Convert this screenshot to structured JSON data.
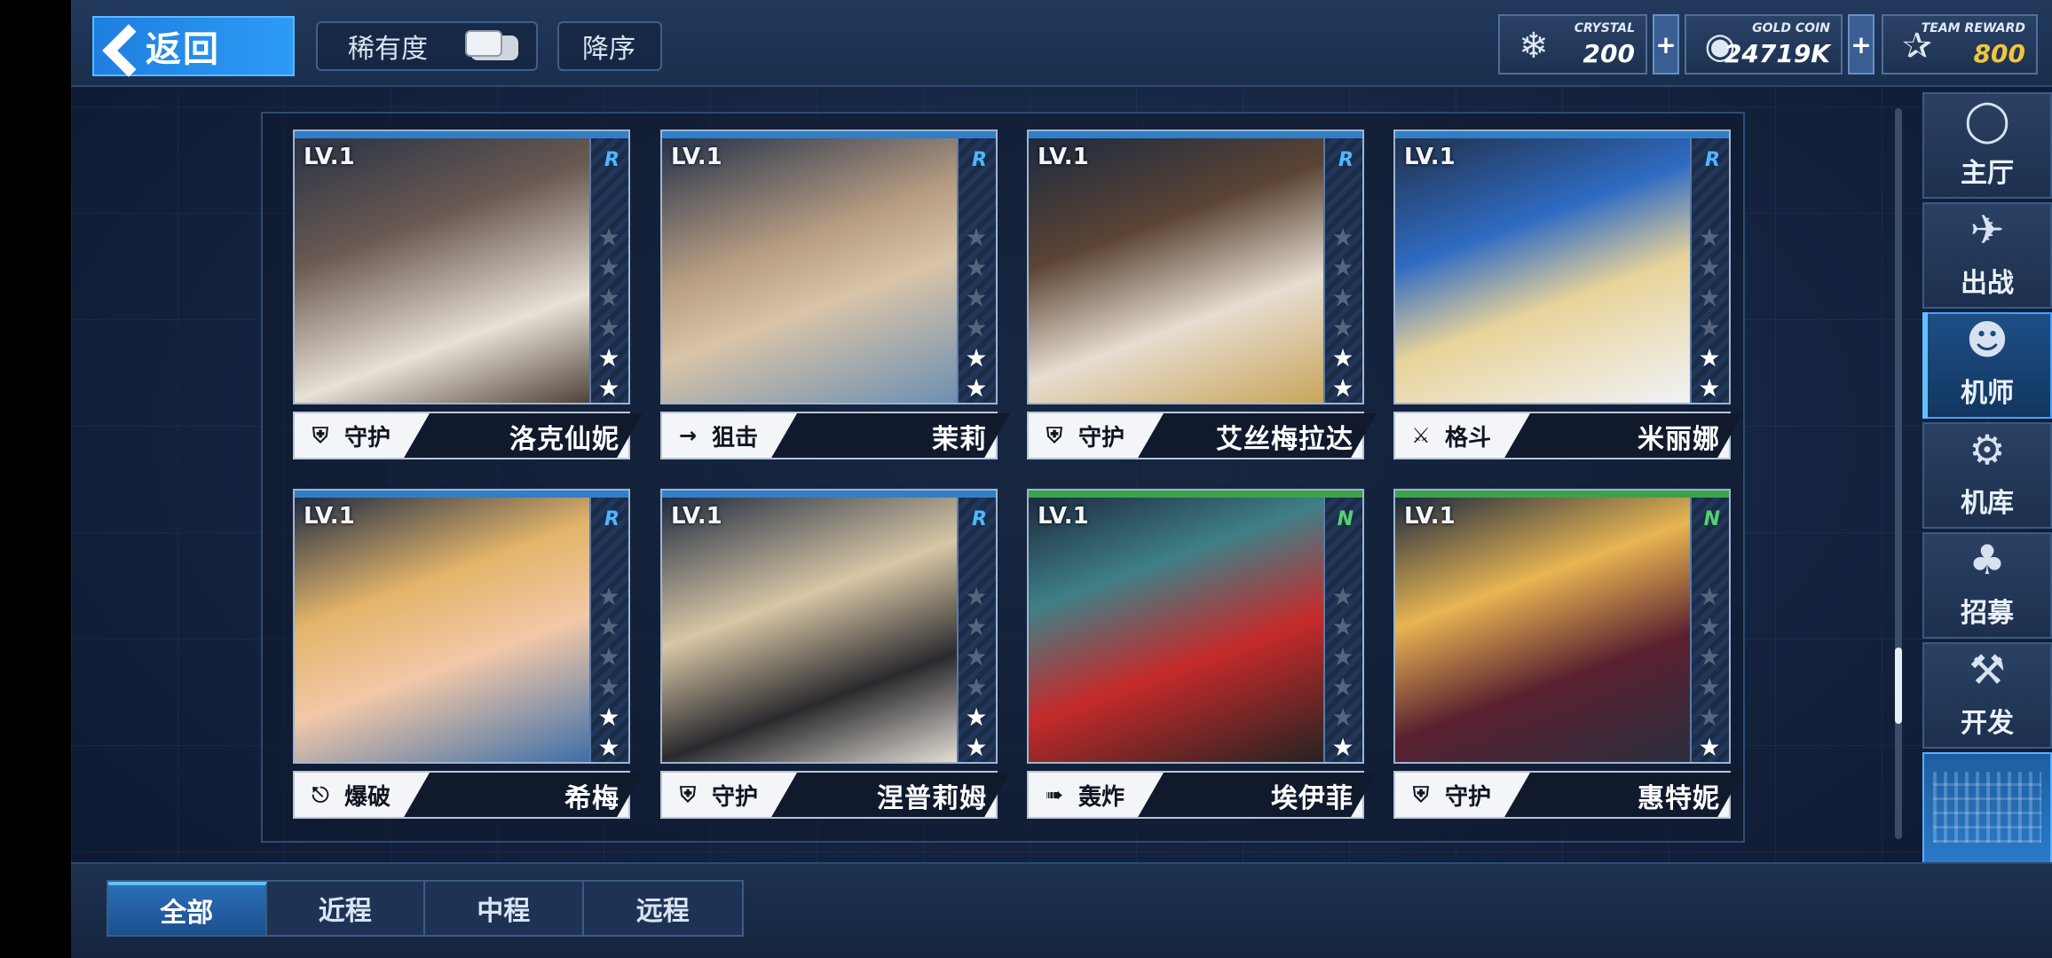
{
  "topbar": {
    "back_label": "返回",
    "rarity_label": "稀有度",
    "order_label": "降序",
    "resources": [
      {
        "name": "CRYSTAL",
        "value": "200",
        "icon": "crystal-icon"
      },
      {
        "name": "GOLD COIN",
        "value": "24719K",
        "icon": "gold-coin-icon"
      },
      {
        "name": "TEAM REWARD",
        "value": "800",
        "icon": "team-reward-icon"
      }
    ],
    "plus": "+"
  },
  "cards": [
    {
      "level": "LV.1",
      "rarity": "R",
      "stars": 2,
      "class": "守护",
      "class_icon": "shield-icon",
      "name": "洛克仙妮"
    },
    {
      "level": "LV.1",
      "rarity": "R",
      "stars": 2,
      "class": "狙击",
      "class_icon": "sniper-rifle-icon",
      "name": "茉莉"
    },
    {
      "level": "LV.1",
      "rarity": "R",
      "stars": 2,
      "class": "守护",
      "class_icon": "shield-icon",
      "name": "艾丝梅拉达"
    },
    {
      "level": "LV.1",
      "rarity": "R",
      "stars": 2,
      "class": "格斗",
      "class_icon": "crossed-swords-icon",
      "name": "米丽娜"
    },
    {
      "level": "LV.1",
      "rarity": "R",
      "stars": 2,
      "class": "爆破",
      "class_icon": "launcher-icon",
      "name": "希梅"
    },
    {
      "level": "LV.1",
      "rarity": "R",
      "stars": 2,
      "class": "守护",
      "class_icon": "shield-icon",
      "name": "涅普莉姆"
    },
    {
      "level": "LV.1",
      "rarity": "N",
      "stars": 1,
      "class": "轰炸",
      "class_icon": "mortar-icon",
      "name": "埃伊菲"
    },
    {
      "level": "LV.1",
      "rarity": "N",
      "stars": 1,
      "class": "守护",
      "class_icon": "shield-icon",
      "name": "惠特妮"
    }
  ],
  "max_stars": 6,
  "nav": [
    {
      "label": "主厅",
      "icon": "hall-icon"
    },
    {
      "label": "出战",
      "icon": "sortie-icon"
    },
    {
      "label": "机师",
      "icon": "pilot-icon",
      "active": true
    },
    {
      "label": "机库",
      "icon": "hangar-icon"
    },
    {
      "label": "招募",
      "icon": "recruit-card-icon"
    },
    {
      "label": "开发",
      "icon": "develop-tools-icon"
    }
  ],
  "filters": [
    {
      "label": "全部",
      "active": true
    },
    {
      "label": "近程"
    },
    {
      "label": "中程"
    },
    {
      "label": "远程"
    }
  ],
  "colors": {
    "accent": "#2d9bf5",
    "rarity_r": "#4fb6ff",
    "rarity_n": "#53d36b",
    "team_reward": "#f3c53a"
  }
}
